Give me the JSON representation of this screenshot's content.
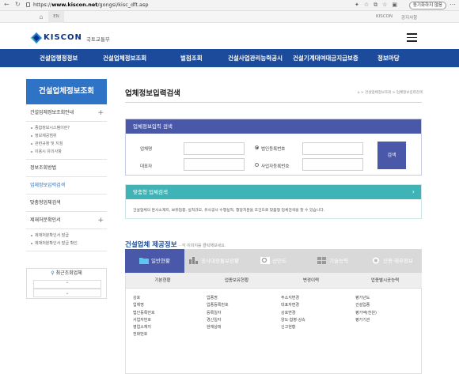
{
  "browser": {
    "url_prefix": "https://",
    "url_host": "www.kiscon.net",
    "url_path": "/gongsi/kisc_dft.asp",
    "sync_button": "동기화하지 않음",
    "back_glyph": "←",
    "refresh_glyph": "↻",
    "more_glyph": "⋯"
  },
  "util": {
    "home_glyph": "⌂",
    "lang": "EN",
    "links": [
      "KISCON",
      "공지사항"
    ]
  },
  "logo": {
    "brand": "KISCON",
    "sub": "국토교통부",
    "colors": [
      "#1f7fd8",
      "#0b3180",
      "#3fb3b5"
    ]
  },
  "gnb": [
    "건설업행정정보",
    "건설업체정보조회",
    "벌점조회",
    "건설사업관리능력공시",
    "건설기계대여대금지급보증",
    "정보마당"
  ],
  "sidebar": {
    "title": "건설업체정보조회",
    "menu_guide": "건설업체정보조회안내",
    "guide_items": [
      "종합정보시스템이란?",
      "정보제공범위",
      "관련규정 및 지침",
      "이용시 유의사항"
    ],
    "info_method": "정보조회방법",
    "company_search": "업체정보입력검색",
    "custom_search": "맞춤형업체검색",
    "sanction": "제재처분확인서",
    "sanction_items": [
      "제재처분확인서 발급",
      "제재처분확인서 발급 확인"
    ],
    "plus": "+",
    "recent_title": "최근조회업체",
    "recent_icon": "magnifier-icon",
    "up_glyph": "⌃",
    "down_glyph": "⌄"
  },
  "page": {
    "title": "업체정보입력검색",
    "breadcrumb": "⌂ > 건설업체정보조회 > 업체정보입력검색"
  },
  "search_box": {
    "header": "업체정보입력 검색",
    "company_label": "업체명",
    "rep_label": "대표자",
    "corp_reg_label": "법인등록번호",
    "biz_reg_label": "사업자등록번호",
    "corp_reg_selected": true,
    "button": "검색"
  },
  "custom_box": {
    "header": "맞춤형 업체검색",
    "arrow": "›",
    "desc": "건설업체의 본사소재지, 보유업종, 실적규모, 유사공사 수행실적, 행정처분을 조건으로 맞춤형 업체검색을 할 수 있습니다."
  },
  "info_section": {
    "title": "건설업체 제공정보",
    "note": "- 각 이미지를 클릭해보세요."
  },
  "tabs": [
    {
      "label": "일반현황",
      "icon": "folder-icon",
      "active": true
    },
    {
      "label": "공사대장통보상황",
      "icon": "chart-icon",
      "active": false
    },
    {
      "label": "신인도",
      "icon": "magnifier-icon",
      "active": false
    },
    {
      "label": "기술능력",
      "icon": "puzzle-icon",
      "active": false
    },
    {
      "label": "신용·재무정보",
      "icon": "coin-icon",
      "active": false
    }
  ],
  "columns": [
    {
      "header": "기본현황",
      "items": [
        "상호",
        "업체명",
        "법인등록번호",
        "사업자번호",
        "영업소재지",
        "전화번호"
      ]
    },
    {
      "header": "업종보유현황",
      "items": [
        "업종명",
        "업종등록번호",
        "등록일자",
        "경신일자",
        "현재상태"
      ]
    },
    {
      "header": "변경이력",
      "items": [
        "주소지변경",
        "대표자변경",
        "상호변경",
        "양도·합병·상속",
        "신고현황"
      ]
    },
    {
      "header": "업종별시공능력",
      "items": [
        "평가년도",
        "건설업종",
        "평가액(천원)",
        "평가기관"
      ]
    }
  ],
  "accent_colors": {
    "gnb": "#1b4b9a",
    "sidebar_head": "#2f73c6",
    "search": "#4958a9",
    "custom": "#3fb3b5"
  }
}
